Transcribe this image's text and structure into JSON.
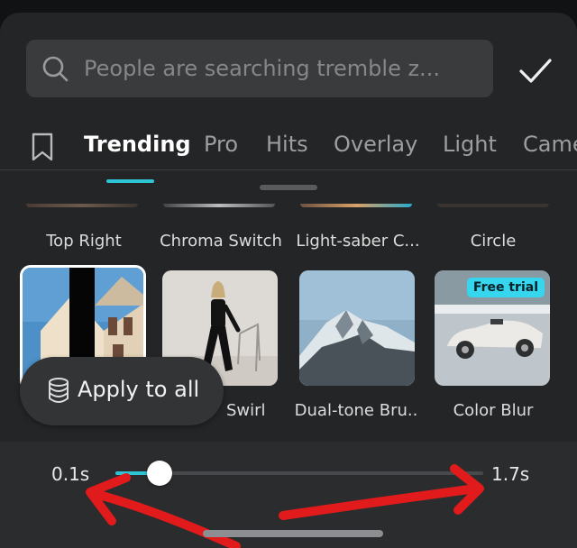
{
  "search": {
    "placeholder": "People are searching tremble z...",
    "value": "",
    "icon": "search-icon"
  },
  "confirm": {
    "icon": "checkmark-icon"
  },
  "tabs": {
    "bookmark_icon": "bookmark-icon",
    "items": [
      {
        "label": "Trending",
        "active": true
      },
      {
        "label": "Pro"
      },
      {
        "label": "Hits"
      },
      {
        "label": "Overlay"
      },
      {
        "label": "Light"
      },
      {
        "label": "Came"
      }
    ]
  },
  "effects_prev_row": [
    "Top Right",
    "Chroma Switch",
    "Light-saber C...",
    "Circle"
  ],
  "effects": [
    {
      "label": "Swirl",
      "selected": true
    },
    {
      "label": "Swirl"
    },
    {
      "label": "Dual-tone Bru.."
    },
    {
      "label": "Color Blur",
      "badge": "Free trial"
    }
  ],
  "apply_all": {
    "label": "Apply to all",
    "icon": "layers-stack-icon"
  },
  "duration": {
    "min_label": "0.1s",
    "max_label": "1.7s",
    "value_fraction": 0.12
  },
  "colors": {
    "accent": "#2ec4d6",
    "badge": "#35d6ee",
    "annotation": "#e11b1b"
  }
}
